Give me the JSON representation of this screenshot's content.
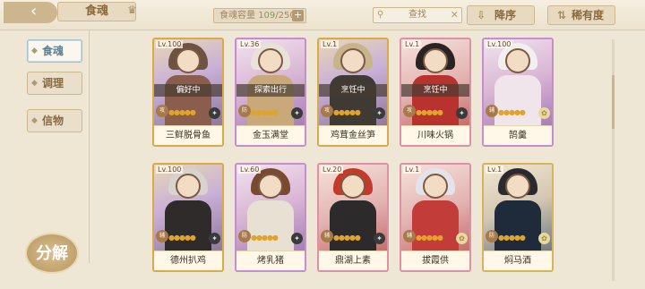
{
  "header": {
    "title": "食魂",
    "capacity_label": "食魂容量",
    "capacity_current": "109",
    "capacity_total": "/250",
    "search_placeholder": "查找",
    "sort_label": "降序",
    "rarity_label": "稀有度"
  },
  "sidebar": {
    "items": [
      {
        "label": "食魂",
        "active": true
      },
      {
        "label": "调理",
        "active": false
      },
      {
        "label": "信物",
        "active": false
      }
    ],
    "decompose_label": "分解"
  },
  "cards": [
    {
      "level": "Lv.100",
      "status": "偏好中",
      "name": "三鲜脱骨鱼",
      "stars": "●●●●●"
    },
    {
      "level": "Lv.36",
      "status": "探索出行",
      "name": "金玉满堂",
      "stars": "●●●●●"
    },
    {
      "level": "Lv.1",
      "status": "烹饪中",
      "name": "鸡茸金丝笋",
      "stars": "●●●●●"
    },
    {
      "level": "Lv.1",
      "status": "烹饪中",
      "name": "川味火锅",
      "stars": "●●●●●"
    },
    {
      "level": "Lv.100",
      "status": "",
      "name": "鹄羹",
      "stars": "●●●●●"
    },
    {
      "level": "Lv.100",
      "status": "",
      "name": "德州扒鸡",
      "stars": "●●●●●"
    },
    {
      "level": "Lv.60",
      "status": "",
      "name": "烤乳猪",
      "stars": "●●●●●"
    },
    {
      "level": "Lv.20",
      "status": "",
      "name": "鼎湖上素",
      "stars": "●●●●●"
    },
    {
      "level": "Lv.1",
      "status": "",
      "name": "拔霞供",
      "stars": "●●●●●"
    },
    {
      "level": "Lv.1",
      "status": "",
      "name": "焖马酒",
      "stars": "●●●●●"
    }
  ],
  "colors": {
    "accent": "#d9b35a",
    "background": "#efe7d6"
  }
}
